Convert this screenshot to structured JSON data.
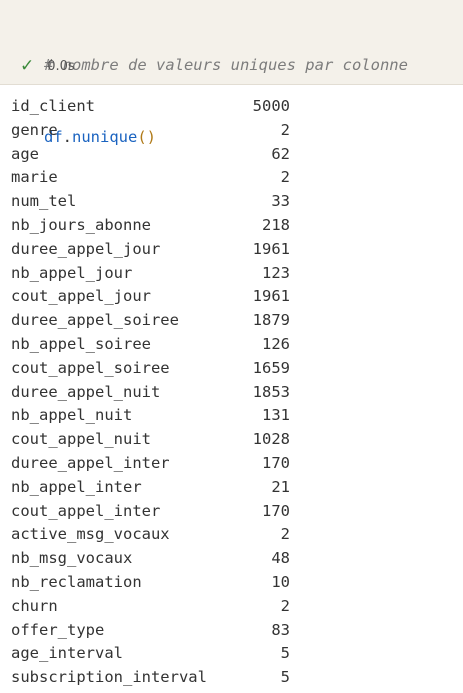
{
  "cell": {
    "comment": "# nombre de valeurs uniques par colonne",
    "code_obj": "df",
    "code_dot": ".",
    "code_fn": "nunique",
    "code_paren": "()",
    "status_icon": "check-icon",
    "status_time": "0.0s"
  },
  "output": {
    "rows": [
      {
        "name": "id_client",
        "value": "5000"
      },
      {
        "name": "genre",
        "value": "2"
      },
      {
        "name": "age",
        "value": "62"
      },
      {
        "name": "marie",
        "value": "2"
      },
      {
        "name": "num_tel",
        "value": "33"
      },
      {
        "name": "nb_jours_abonne",
        "value": "218"
      },
      {
        "name": "duree_appel_jour",
        "value": "1961"
      },
      {
        "name": "nb_appel_jour",
        "value": "123"
      },
      {
        "name": "cout_appel_jour",
        "value": "1961"
      },
      {
        "name": "duree_appel_soiree",
        "value": "1879"
      },
      {
        "name": "nb_appel_soiree",
        "value": "126"
      },
      {
        "name": "cout_appel_soiree",
        "value": "1659"
      },
      {
        "name": "duree_appel_nuit",
        "value": "1853"
      },
      {
        "name": "nb_appel_nuit",
        "value": "131"
      },
      {
        "name": "cout_appel_nuit",
        "value": "1028"
      },
      {
        "name": "duree_appel_inter",
        "value": "170"
      },
      {
        "name": "nb_appel_inter",
        "value": "21"
      },
      {
        "name": "cout_appel_inter",
        "value": "170"
      },
      {
        "name": "active_msg_vocaux",
        "value": "2"
      },
      {
        "name": "nb_msg_vocaux",
        "value": "48"
      },
      {
        "name": "nb_reclamation",
        "value": "10"
      },
      {
        "name": "churn",
        "value": "2"
      },
      {
        "name": "offer_type",
        "value": "83"
      },
      {
        "name": "age_interval",
        "value": "5"
      },
      {
        "name": "subscription_interval",
        "value": "5"
      }
    ]
  }
}
